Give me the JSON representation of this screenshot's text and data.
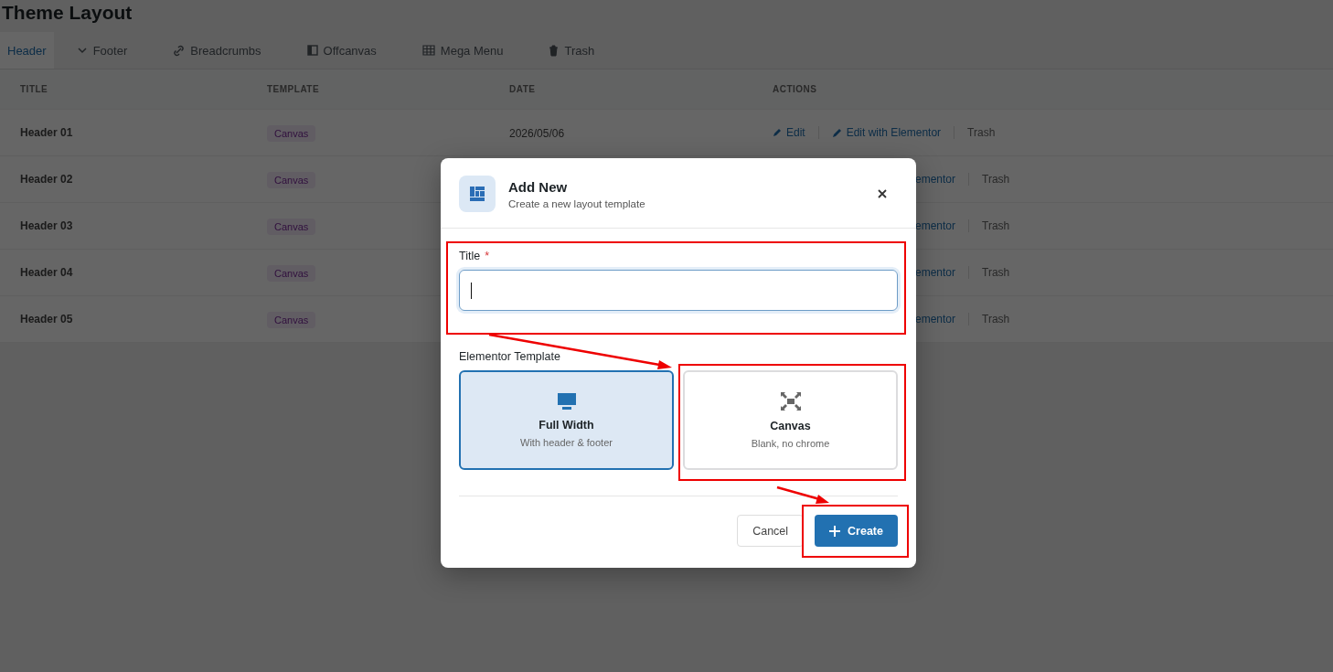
{
  "page": {
    "title": "Theme Layout"
  },
  "tabs": [
    {
      "label": "Header",
      "selected": true,
      "kind": "header"
    },
    {
      "label": "Footer",
      "selected": false,
      "kind": "footer"
    },
    {
      "label": "Breadcrumbs",
      "selected": false,
      "kind": "breadcrumbs"
    },
    {
      "label": "Offcanvas",
      "selected": false,
      "kind": "offcanvas"
    },
    {
      "label": "Mega Menu",
      "selected": false,
      "kind": "megamenu"
    },
    {
      "label": "Trash",
      "selected": false,
      "kind": "trash"
    }
  ],
  "table": {
    "columns": [
      "TITLE",
      "TEMPLATE",
      "DATE",
      "ACTIONS"
    ],
    "rows": [
      {
        "title": "Header 01",
        "template": "Canvas",
        "date": "2026/05/06",
        "actions": [
          {
            "kind": "edit",
            "label": "Edit"
          },
          {
            "kind": "elementor",
            "label": "Edit with Elementor"
          },
          {
            "kind": "trash",
            "label": "Trash"
          }
        ]
      },
      {
        "title": "Header 02",
        "template": "Canvas",
        "actions": [
          {
            "kind": "elementor_partial",
            "label": "ementor"
          },
          {
            "kind": "trash",
            "label": "Trash"
          }
        ]
      },
      {
        "title": "Header 03",
        "template": "Canvas",
        "actions": [
          {
            "kind": "elementor_partial",
            "label": "ementor"
          },
          {
            "kind": "trash",
            "label": "Trash"
          }
        ]
      },
      {
        "title": "Header 04",
        "template": "Canvas",
        "actions": [
          {
            "kind": "elementor_partial",
            "label": "ementor"
          },
          {
            "kind": "trash",
            "label": "Trash"
          }
        ]
      },
      {
        "title": "Header 05",
        "template": "Canvas",
        "actions": [
          {
            "kind": "elementor_partial",
            "label": "ementor"
          },
          {
            "kind": "trash",
            "label": "Trash"
          }
        ]
      }
    ]
  },
  "dialog": {
    "title": "Add New",
    "subtitle": "Create a new layout template",
    "title_field": {
      "label": "Title",
      "required_mark": "*"
    },
    "template_label": "Elementor Template",
    "templates": [
      {
        "kind": "full_width",
        "name": "Full Width",
        "description": "With header & footer",
        "selected": true
      },
      {
        "kind": "canvas",
        "name": "Canvas",
        "description": "Blank, no chrome",
        "selected": false
      }
    ],
    "buttons": [
      {
        "kind": "secondary",
        "label": "Cancel"
      },
      {
        "kind": "primary",
        "label": "Create"
      }
    ]
  }
}
